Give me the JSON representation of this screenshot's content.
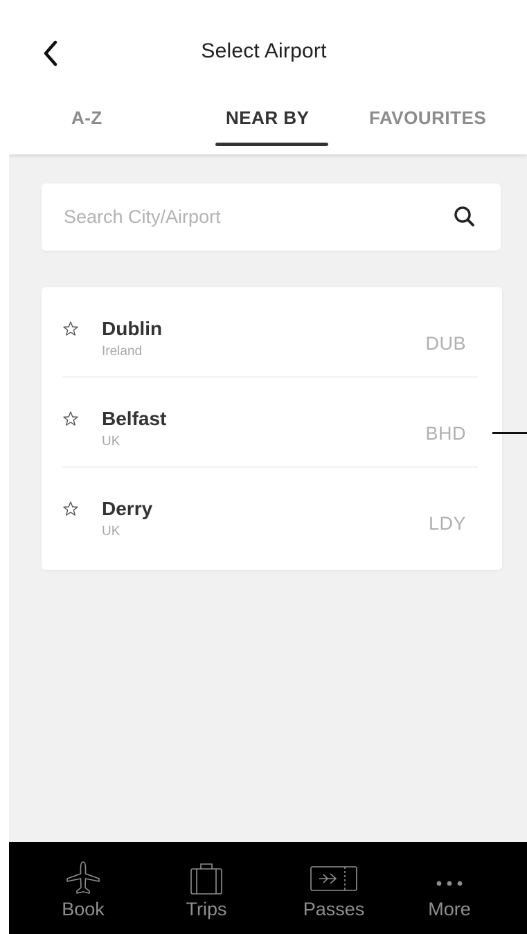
{
  "header": {
    "title": "Select Airport",
    "back_icon": "chevron-left-icon"
  },
  "tabs": [
    {
      "label": "A-Z",
      "active": false
    },
    {
      "label": "NEAR BY",
      "active": true
    },
    {
      "label": "FAVOURITES",
      "active": false
    }
  ],
  "search": {
    "placeholder": "Search City/Airport",
    "value": "",
    "icon": "search-icon"
  },
  "airports": [
    {
      "city": "Dublin",
      "country": "Ireland",
      "code": "DUB",
      "favourite": false
    },
    {
      "city": "Belfast",
      "country": "UK",
      "code": "BHD",
      "favourite": false
    },
    {
      "city": "Derry",
      "country": "UK",
      "code": "LDY",
      "favourite": false
    }
  ],
  "bottom_nav": [
    {
      "label": "Book",
      "icon": "airplane-icon"
    },
    {
      "label": "Trips",
      "icon": "suitcase-icon"
    },
    {
      "label": "Passes",
      "icon": "boarding-pass-icon"
    },
    {
      "label": "More",
      "icon": "more-dots-icon"
    }
  ],
  "colors": {
    "background": "#f1f1f1",
    "card": "#ffffff",
    "active_tab": "#333333",
    "inactive_tab": "#8c8c8c",
    "tabbar": "#000000",
    "tabbar_text": "#8e8e8e"
  }
}
